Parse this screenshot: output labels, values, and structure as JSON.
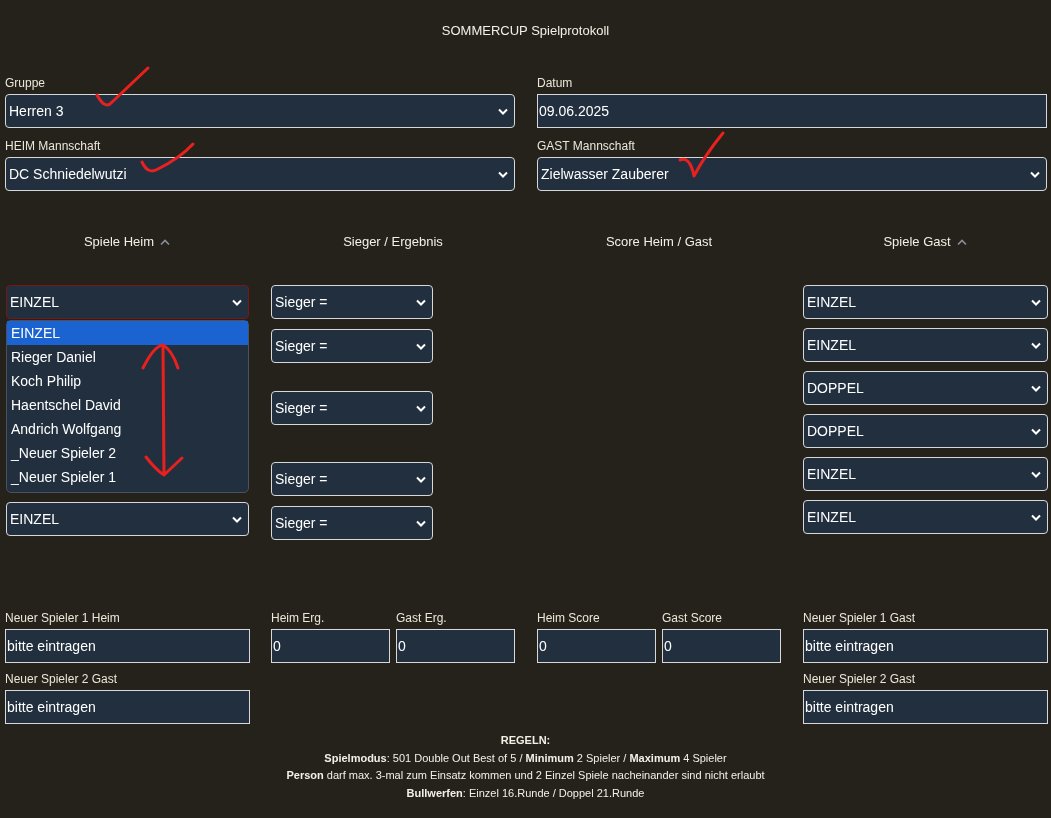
{
  "title": "SOMMERCUP Spielprotokoll",
  "top_fields": [
    {
      "label": "Gruppe",
      "kind": "select",
      "value": "Herren 3"
    },
    {
      "label": "Datum",
      "kind": "input",
      "value": "09.06.2025"
    },
    {
      "label": "HEIM Mannschaft",
      "kind": "select",
      "value": "DC Schniedelwutzi"
    },
    {
      "label": "GAST Mannschaft",
      "kind": "select",
      "value": "Zielwasser Zauberer"
    }
  ],
  "column_headers": [
    {
      "label": "Spiele Heim",
      "sortable": true
    },
    {
      "label": "Sieger / Ergebnis",
      "sortable": false
    },
    {
      "label": "Score Heim / Gast",
      "sortable": false
    },
    {
      "label": "Spiele Gast",
      "sortable": true
    }
  ],
  "home_games": {
    "first": {
      "value": "EINZEL",
      "focused": true,
      "expanded": true,
      "options": [
        {
          "label": "EINZEL",
          "selected": true
        },
        {
          "label": "Rieger Daniel",
          "selected": false
        },
        {
          "label": "Koch Philip",
          "selected": false
        },
        {
          "label": "Haentschel David",
          "selected": false
        },
        {
          "label": "Andrich Wolfgang",
          "selected": false
        },
        {
          "label": "_Neuer Spieler 2",
          "selected": false
        },
        {
          "label": "_Neuer Spieler 1",
          "selected": false
        }
      ]
    },
    "last": {
      "value": "EINZEL",
      "focused": false
    }
  },
  "winners": [
    "Sieger =",
    "Sieger =",
    "Sieger =",
    "Sieger =",
    "Sieger ="
  ],
  "guest_games": [
    "EINZEL",
    "EINZEL",
    "DOPPEL",
    "DOPPEL",
    "EINZEL",
    "EINZEL"
  ],
  "bottom_fields": [
    [
      {
        "label": "Neuer Spieler 1 Heim",
        "value": "bitte eintragen"
      }
    ],
    [
      {
        "label": "Heim Erg.",
        "value": "0"
      },
      {
        "label": "Gast Erg.",
        "value": "0"
      }
    ],
    [
      {
        "label": "Heim Score",
        "value": "0"
      },
      {
        "label": "Gast Score",
        "value": "0"
      }
    ],
    [
      {
        "label": "Neuer Spieler 1 Gast",
        "value": "bitte eintragen"
      }
    ]
  ],
  "second_fields": [
    {
      "label": "Neuer Spieler 2 Gast",
      "value": "bitte eintragen"
    },
    {
      "label": "Neuer Spieler 2 Gast",
      "value": "bitte eintragen"
    }
  ],
  "rules": {
    "heading": "REGELN:",
    "lines": [
      "**Spielmodus**: 501 Double Out Best of 5 / **Minimum** 2 Spieler / **Maximum** 4 Spieler",
      "**Person** darf max. 3-mal zum Einsatz kommen und 2 Einzel Spiele nacheinander sind nicht erlaubt",
      "**Bullwerfen**: Einzel 16.Runde / Doppel 21.Runde"
    ]
  }
}
